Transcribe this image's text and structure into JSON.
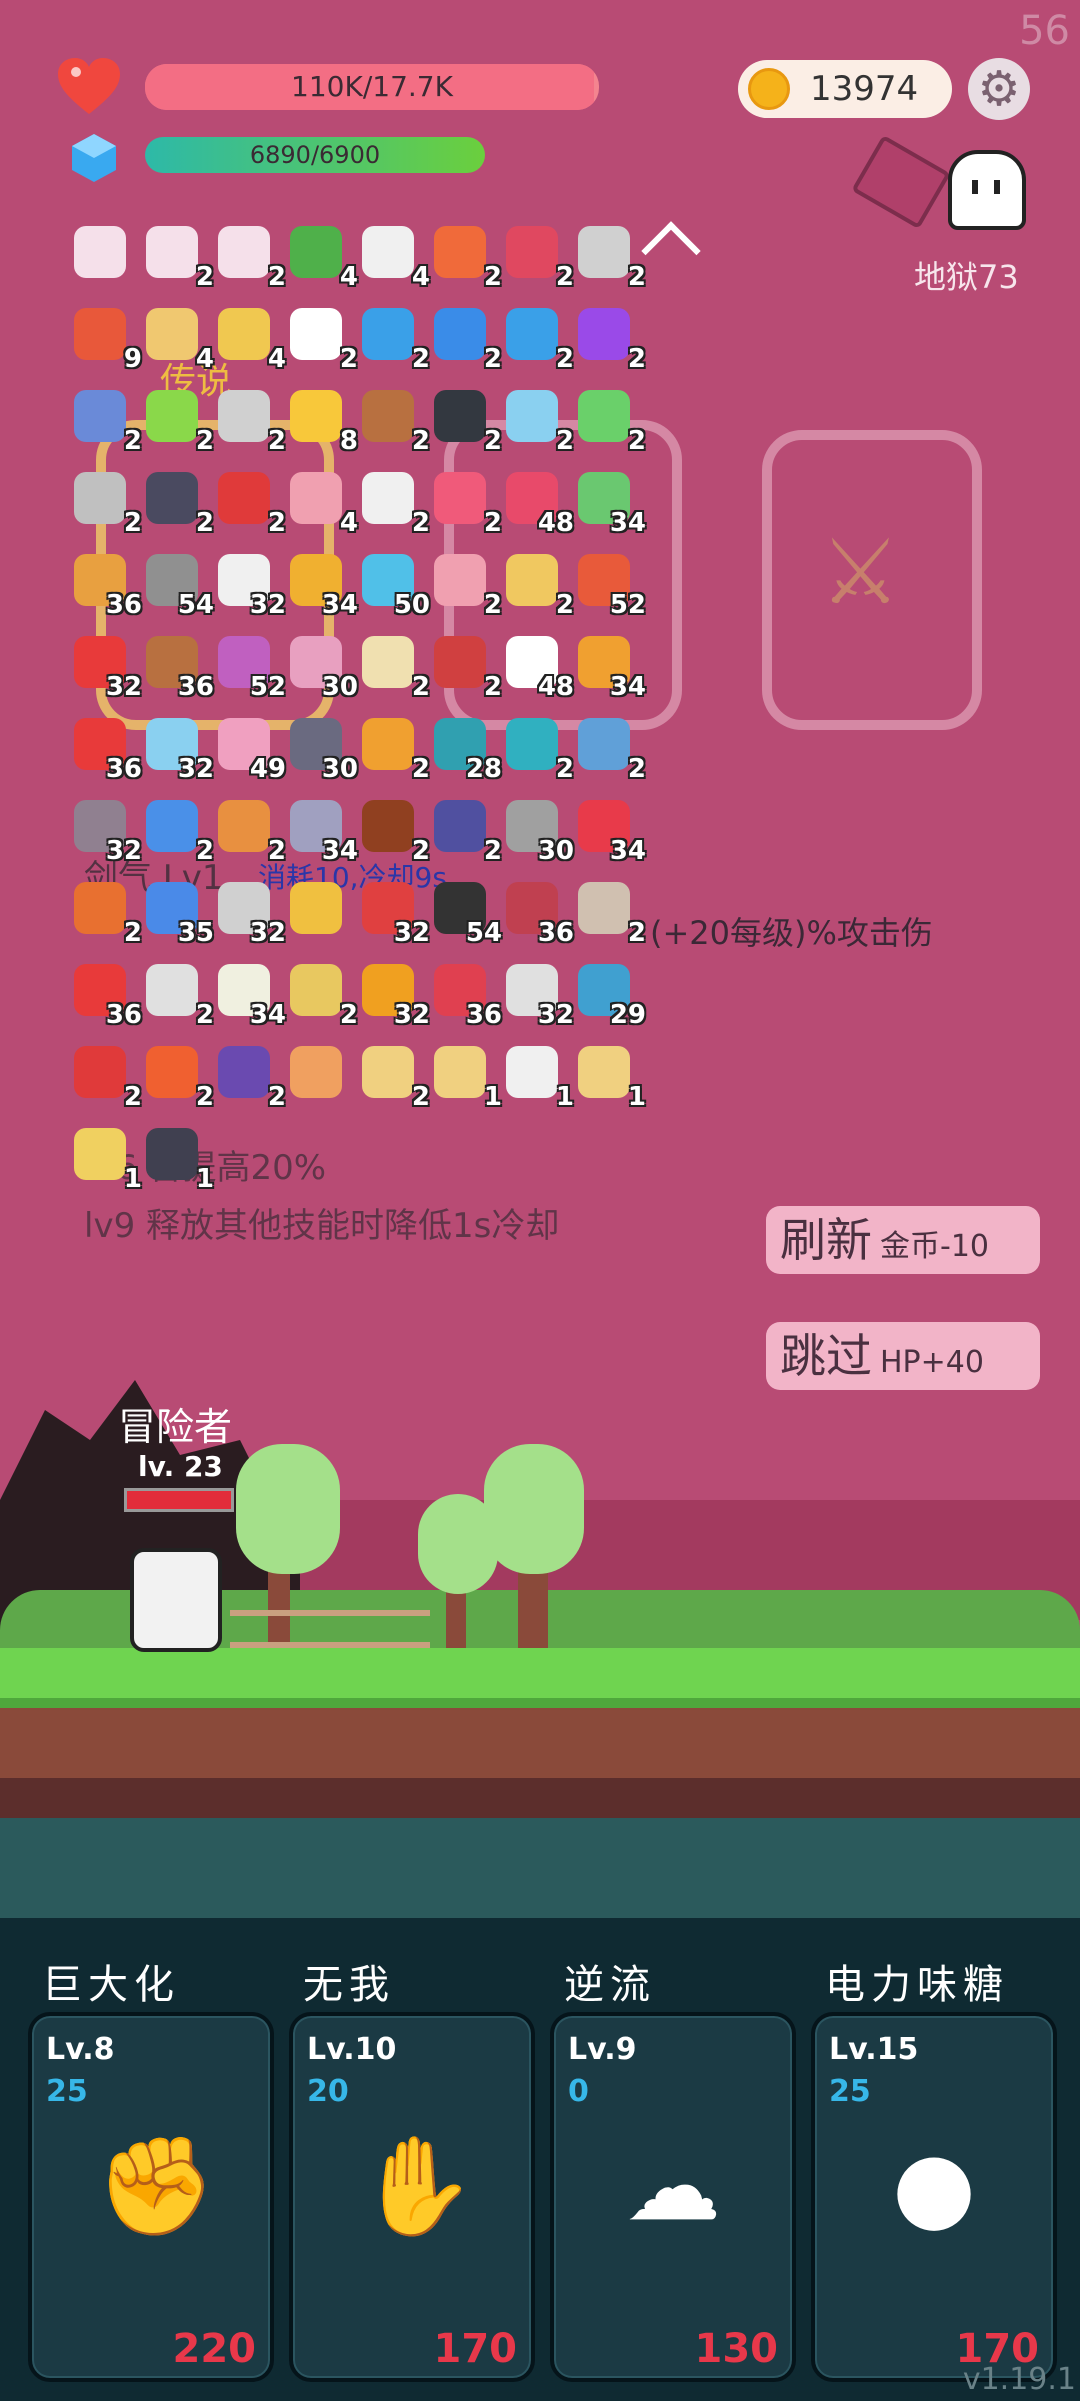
{
  "fps": "56",
  "hp": {
    "text": "110K/17.7K",
    "fill": 0.99
  },
  "mp": {
    "text": "6890/6900",
    "fill": 0.998
  },
  "gold": "13974",
  "stage": "地狱73",
  "legend_label": "传说",
  "items": [
    [
      "",
      "2",
      "2",
      "4",
      "4",
      "2",
      "2",
      "2"
    ],
    [
      "9",
      "4",
      "4",
      "2",
      "2",
      "2",
      "2",
      "2"
    ],
    [
      "2",
      "2",
      "2",
      "8",
      "2",
      "2",
      "2",
      "2"
    ],
    [
      "2",
      "2",
      "2",
      "4",
      "2",
      "2",
      "48",
      "34"
    ],
    [
      "36",
      "54",
      "32",
      "34",
      "50",
      "2",
      "2",
      "52"
    ],
    [
      "32",
      "36",
      "52",
      "30",
      "2",
      "2",
      "48",
      "34"
    ],
    [
      "36",
      "32",
      "49",
      "30",
      "2",
      "28",
      "2",
      "2"
    ],
    [
      "32",
      "2",
      "2",
      "34",
      "2",
      "2",
      "30",
      "34"
    ],
    [
      "2",
      "35",
      "32",
      "",
      "32",
      "54",
      "36",
      "2"
    ],
    [
      "36",
      "2",
      "34",
      "2",
      "32",
      "36",
      "32",
      "29"
    ],
    [
      "2",
      "2",
      "2",
      "",
      "2",
      "1",
      "1",
      "1"
    ],
    [
      "1",
      "1"
    ]
  ],
  "colors": [
    "#f5e0ea",
    "#f5e0ea",
    "#f5e0ea",
    "#4fb04a",
    "#f0f0f0",
    "#f06a3a",
    "#e04860",
    "#d0d0d0",
    "#e8583a",
    "#f0c870",
    "#f0c850",
    "#ffffff",
    "#3aa0e8",
    "#3a8ce8",
    "#3aa0e8",
    "#9a4ae8",
    "#6a8ad8",
    "#8ad84a",
    "#d0d0d0",
    "#f8c83a",
    "#b87040",
    "#333840",
    "#8ad0f0",
    "#6ad06a",
    "#c0c0c0",
    "#4a4a60",
    "#e03a3a",
    "#f0a0b0",
    "#f0f0f0",
    "#f05a7a",
    "#e84a6a",
    "#6ac870",
    "#e8a040",
    "#909090",
    "#f0f0f0",
    "#f0b030",
    "#50c0e8",
    "#f0a0b0",
    "#f0c860",
    "#e85a3a",
    "#e83a3a",
    "#b87040",
    "#c060c0",
    "#e8a0c0",
    "#f0e0b0",
    "#d04040",
    "#ffffff",
    "#f0a030",
    "#e83a3a",
    "#8ad0f0",
    "#f0a0c0",
    "#6a6a80",
    "#f0a030",
    "#30a0b0",
    "#30b0c0",
    "#60a0d8",
    "#908090",
    "#4a90e8",
    "#e89040",
    "#a0a0c0",
    "#904020",
    "#5050a0",
    "#a0a0a0",
    "#e83a4a",
    "#e87030",
    "#4a8ae8",
    "#d0d0d0",
    "#f0c040",
    "#e04040",
    "#333333",
    "#c04050",
    "#d0c0b0",
    "#e83a3a",
    "#e0e0e0",
    "#f0f0e0",
    "#e8c860",
    "#f0a020",
    "#e04050",
    "#e0e0e0",
    "#40a0d0",
    "#e03a3a",
    "#f06030",
    "#6a4ab0",
    "#f0a060",
    "#f0d080",
    "#f0d080",
    "#f0f0f0",
    "#f0d080",
    "#f0d060",
    "#404050"
  ],
  "skill_line": "剑气 Lv1",
  "skill_cost": "消耗10,冷却9s",
  "skill_desc_pre": "(+20每级)%攻击伤",
  "lv6": "6  害提高20%",
  "lv9": "lv9 释放其他技能时降低1s冷却",
  "refresh": {
    "label": "刷新",
    "sub": "金币-10"
  },
  "skip": {
    "label": "跳过",
    "sub": "HP+40"
  },
  "hero": {
    "name": "冒险者",
    "level": "lv. 23"
  },
  "skills": [
    {
      "title": "巨大化",
      "lv": "Lv.8",
      "num": "25",
      "cost": "220",
      "icon": "fist-icon",
      "glyph": "✊"
    },
    {
      "title": "无我",
      "lv": "Lv.10",
      "num": "20",
      "cost": "170",
      "icon": "eye-hand-icon",
      "glyph": "✋"
    },
    {
      "title": "逆流",
      "lv": "Lv.9",
      "num": "0",
      "cost": "130",
      "icon": "wing-icon",
      "glyph": "☁"
    },
    {
      "title": "电力味糖",
      "lv": "Lv.15",
      "num": "25",
      "cost": "170",
      "icon": "lollipop-icon",
      "glyph": "●"
    }
  ],
  "version": "v1.19.1"
}
